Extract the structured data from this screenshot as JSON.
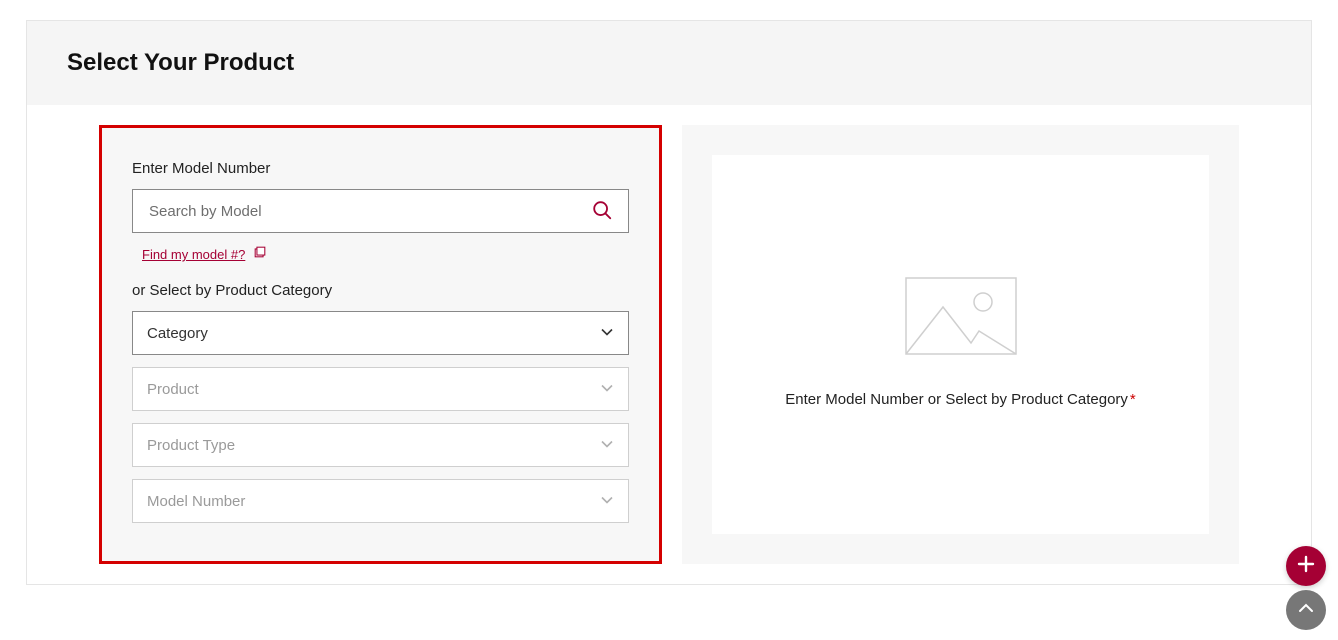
{
  "header": {
    "title": "Select Your Product"
  },
  "left": {
    "enter_label": "Enter Model Number",
    "search_placeholder": "Search by Model",
    "find_link": "Find my model #?",
    "or_label": "or Select by Product Category",
    "selects": {
      "category": "Category",
      "product": "Product",
      "product_type": "Product Type",
      "model_number": "Model Number"
    }
  },
  "right": {
    "text": "Enter Model Number or Select by Product Category",
    "required_mark": "*"
  },
  "colors": {
    "accent": "#a50034",
    "highlight_border": "#d40000"
  }
}
